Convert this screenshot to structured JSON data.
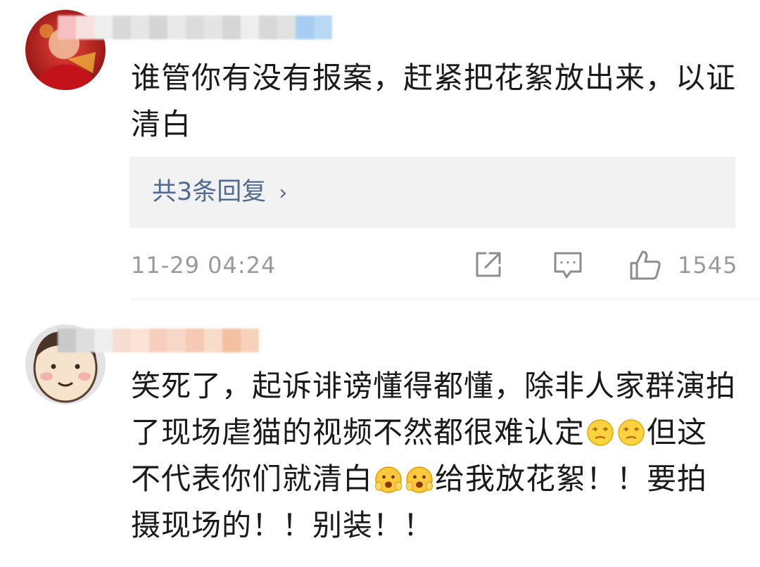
{
  "comments": [
    {
      "text": "谁管你有没有报案，赶紧把花絮放出来，以证清白",
      "replies_label": "共3条回复",
      "timestamp": "11-29 04:24",
      "like_count": "1545"
    },
    {
      "text_part1": "笑死了，起诉诽谤懂得都懂，除非人家群演拍了现场虐猫的视频不然都很难认定",
      "text_part2": "但这不代表你们就清白",
      "text_part3": "给我放花絮！！要拍摄现场的！！别装！！"
    }
  ],
  "icons": {
    "replies_chevron": "›",
    "share": "share-icon",
    "comment": "comment-icon",
    "like": "thumbs-up-icon"
  },
  "colors": {
    "link": "#4f6b94",
    "meta": "#9a9a9a",
    "reply_bg": "#f2f2f2"
  }
}
